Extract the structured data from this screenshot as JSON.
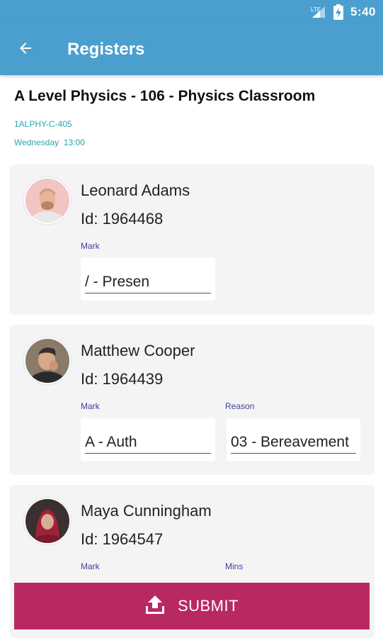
{
  "status_bar": {
    "time": "5:40"
  },
  "app_bar": {
    "title": "Registers"
  },
  "header": {
    "class_title": "A Level Physics - 106 - Physics Classroom",
    "class_code": "1ALPHY-C-405",
    "class_time": "Wednesday  13:00"
  },
  "students": [
    {
      "name": "Leonard Adams",
      "id": "Id: 1964468",
      "mark_label": "Mark",
      "mark_value": "/ - Presen"
    },
    {
      "name": "Matthew Cooper",
      "id": "Id: 1964439",
      "mark_label": "Mark",
      "mark_value": "A - Auth",
      "reason_label": "Reason",
      "reason_value": "03 - Bereavement"
    },
    {
      "name": "Maya Cunningham",
      "id": "Id: 1964547",
      "mark_label": "Mark",
      "mins_label": "Mins"
    }
  ],
  "submit": {
    "label": "SUBMIT"
  },
  "colors": {
    "primary": "#4a9fce",
    "accent": "#b82863",
    "info_text": "#2aa6a8",
    "field_label": "#3f3f9f"
  },
  "icons": {
    "back": "arrow-back-icon",
    "submit": "upload-icon",
    "signal": "signal-icon",
    "battery": "battery-icon"
  }
}
